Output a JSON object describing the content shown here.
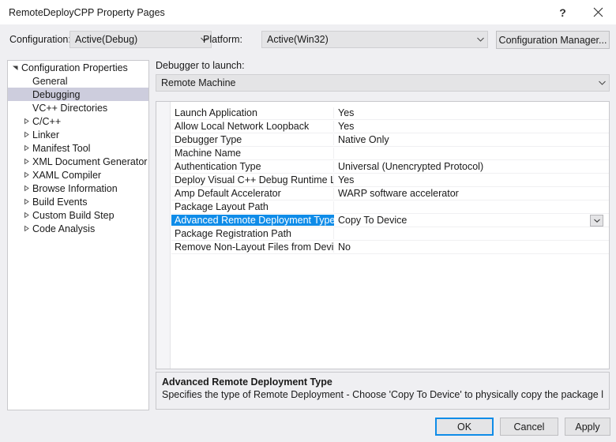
{
  "window": {
    "title": "RemoteDeployCPP Property Pages",
    "help_icon": "question-mark-icon",
    "close_icon": "close-icon"
  },
  "colors": {
    "accent_selection": "#0f8ce8",
    "tree_selection": "#cdcddd",
    "dialog_background": "#efeff2",
    "panel_background": "#ffffff",
    "focus_border": "#0f8ce8"
  },
  "config_bar": {
    "configuration_label": "Configuration:",
    "configuration_value": "Active(Debug)",
    "platform_label": "Platform:",
    "platform_value": "Active(Win32)",
    "configuration_manager_label": "Configuration Manager..."
  },
  "tree": {
    "items": [
      {
        "label": "Configuration Properties",
        "indent": 0,
        "twisty": "expanded",
        "selected": false
      },
      {
        "label": "General",
        "indent": 1,
        "twisty": "none",
        "selected": false
      },
      {
        "label": "Debugging",
        "indent": 1,
        "twisty": "none",
        "selected": true
      },
      {
        "label": "VC++ Directories",
        "indent": 1,
        "twisty": "none",
        "selected": false
      },
      {
        "label": "C/C++",
        "indent": 1,
        "twisty": "collapsed",
        "selected": false
      },
      {
        "label": "Linker",
        "indent": 1,
        "twisty": "collapsed",
        "selected": false
      },
      {
        "label": "Manifest Tool",
        "indent": 1,
        "twisty": "collapsed",
        "selected": false
      },
      {
        "label": "XML Document Generator",
        "indent": 1,
        "twisty": "collapsed",
        "selected": false
      },
      {
        "label": "XAML Compiler",
        "indent": 1,
        "twisty": "collapsed",
        "selected": false
      },
      {
        "label": "Browse Information",
        "indent": 1,
        "twisty": "collapsed",
        "selected": false
      },
      {
        "label": "Build Events",
        "indent": 1,
        "twisty": "collapsed",
        "selected": false
      },
      {
        "label": "Custom Build Step",
        "indent": 1,
        "twisty": "collapsed",
        "selected": false
      },
      {
        "label": "Code Analysis",
        "indent": 1,
        "twisty": "collapsed",
        "selected": false
      }
    ]
  },
  "main": {
    "debugger_label": "Debugger to launch:",
    "debugger_value": "Remote Machine",
    "properties": [
      {
        "name": "Launch Application",
        "value": "Yes",
        "selected": false
      },
      {
        "name": "Allow Local Network Loopback",
        "value": "Yes",
        "selected": false
      },
      {
        "name": "Debugger Type",
        "value": "Native Only",
        "selected": false
      },
      {
        "name": "Machine Name",
        "value": "",
        "selected": false
      },
      {
        "name": "Authentication Type",
        "value": "Universal (Unencrypted Protocol)",
        "selected": false
      },
      {
        "name": "Deploy Visual C++ Debug Runtime Librari",
        "value": "Yes",
        "selected": false
      },
      {
        "name": "Amp Default Accelerator",
        "value": "WARP software accelerator",
        "selected": false
      },
      {
        "name": "Package Layout Path",
        "value": "",
        "selected": false
      },
      {
        "name": "Advanced Remote Deployment Type",
        "value": "Copy To Device",
        "selected": true
      },
      {
        "name": "Package Registration Path",
        "value": "",
        "selected": false
      },
      {
        "name": "Remove Non-Layout Files from Device",
        "value": "No",
        "selected": false
      }
    ]
  },
  "description": {
    "title": "Advanced Remote Deployment Type",
    "text": "Specifies the type of Remote Deployment - Choose 'Copy To Device' to physically copy the package layout to re..."
  },
  "footer": {
    "ok_label": "OK",
    "cancel_label": "Cancel",
    "apply_label": "Apply"
  }
}
